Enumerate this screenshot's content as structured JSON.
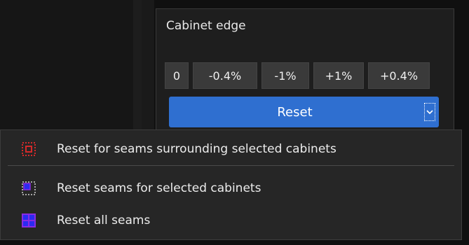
{
  "panel": {
    "title": "Cabinet edge",
    "step_buttons": [
      "0",
      "-0.4%",
      "-1%",
      "+1%",
      "+0.4%"
    ],
    "reset_label": "Reset"
  },
  "menu": {
    "items": [
      {
        "label": "Reset for seams surrounding selected cabinets",
        "icon": "seam-surround-icon"
      },
      {
        "label": "Reset seams for selected cabinets",
        "icon": "seam-selected-icon"
      },
      {
        "label": "Reset all seams",
        "icon": "seam-all-icon"
      }
    ]
  },
  "colors": {
    "accent": "#2f6fd0",
    "icon_red": "#d42a2a",
    "icon_blue": "#2b2bf0",
    "icon_purple": "#8a2be2"
  }
}
